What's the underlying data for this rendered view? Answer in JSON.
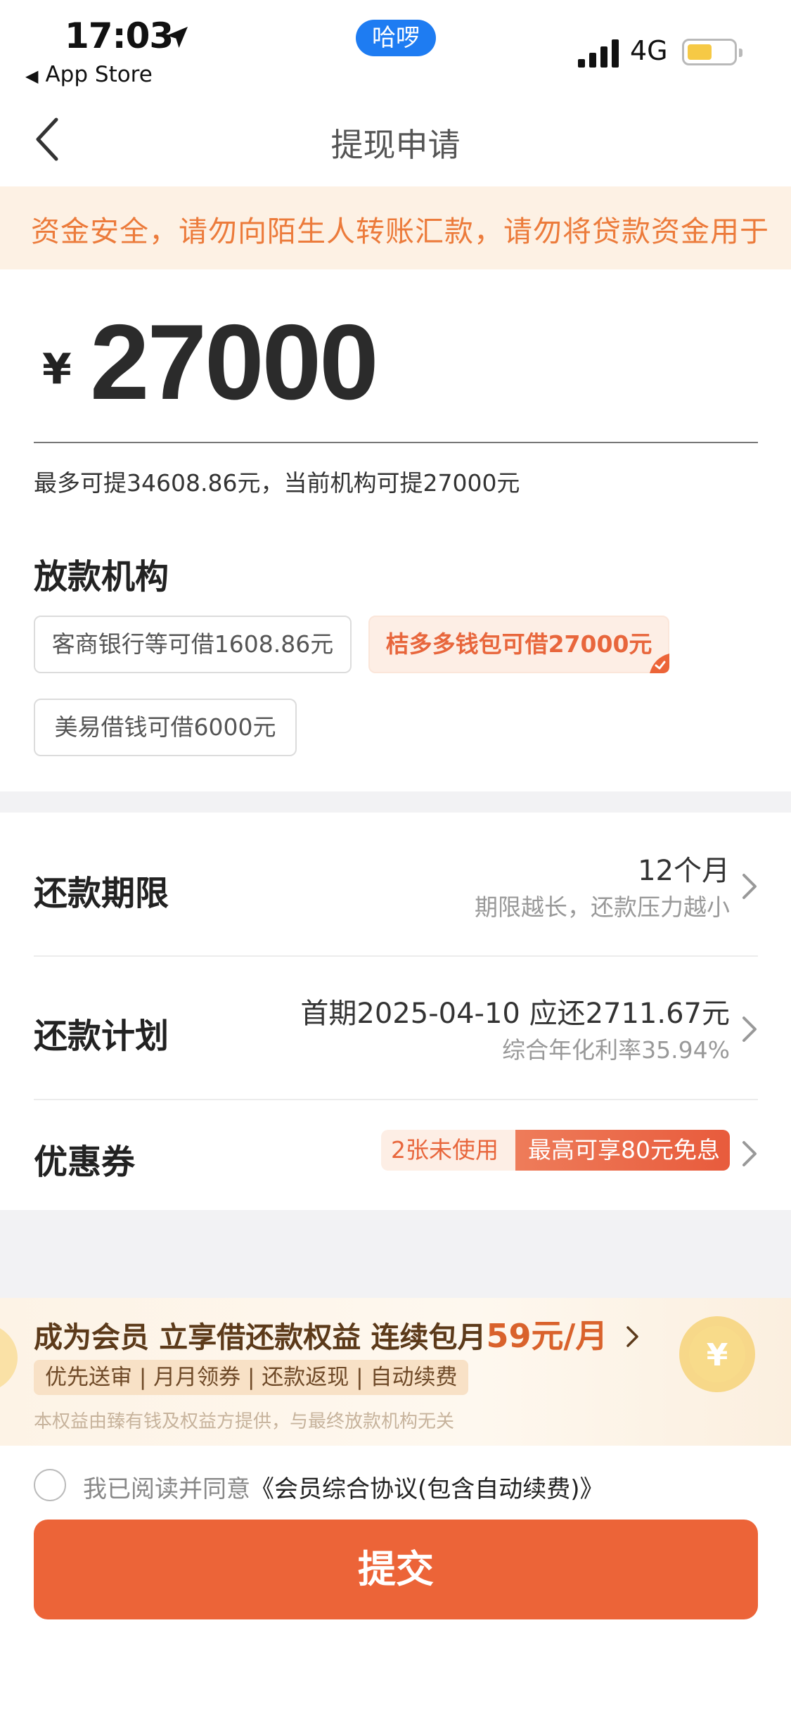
{
  "status_bar": {
    "time": "17:03",
    "back_app": "App Store",
    "hello_pill": "哈啰",
    "network": "4G",
    "battery_level": 0.55
  },
  "nav": {
    "title": "提现申请"
  },
  "notice": {
    "text": "资金安全，请勿向陌生人转账汇款，请勿将贷款资金用于"
  },
  "amount": {
    "currency": "¥",
    "value": "27000",
    "limit_text": "最多可提34608.86元，当前机构可提27000元"
  },
  "institutions": {
    "title": "放款机构",
    "options": [
      {
        "label": "客商银行等可借1608.86元",
        "selected": false
      },
      {
        "label": "桔多多钱包可借27000元",
        "selected": true
      },
      {
        "label": "美易借钱可借6000元",
        "selected": false
      }
    ]
  },
  "term": {
    "label": "还款期限",
    "value": "12个月",
    "hint": "期限越长，还款压力越小"
  },
  "plan": {
    "label": "还款计划",
    "value": "首期2025-04-10 应还2711.67元",
    "hint": "综合年化利率35.94%"
  },
  "coupon": {
    "label": "优惠券",
    "count": "2张未使用",
    "offer": "最高可享80元免息"
  },
  "member": {
    "title_prefix": "成为会员 立享借还款权益 连续包月",
    "price": "59元/月",
    "tags": "优先送审 | 月月领券 | 还款返现 | 自动续费",
    "note": "本权益由臻有钱及权益方提供，与最终放款机构无关"
  },
  "agreement": {
    "prefix": "我已阅读并同意",
    "link": "《会员综合协议(包含自动续费)》",
    "checked": false
  },
  "submit": {
    "label": "提交"
  },
  "colors": {
    "accent": "#ec6438",
    "notice_bg": "#fdf1e4",
    "notice_text": "#ec7b3b",
    "pill_blue": "#1e7cf2"
  }
}
